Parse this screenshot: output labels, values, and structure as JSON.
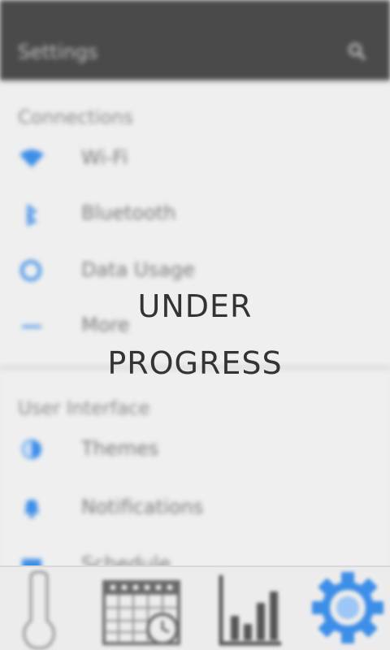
{
  "app_bar": {
    "title": "Settings",
    "search_icon": "search-icon"
  },
  "sections": [
    {
      "header": "Connections",
      "items": [
        {
          "label": "Wi-Fi",
          "icon": "wifi-icon"
        },
        {
          "label": "Bluetooth",
          "icon": "bluetooth-icon"
        },
        {
          "label": "Data Usage",
          "icon": "data-usage-icon"
        },
        {
          "label": "More",
          "icon": "more-icon"
        }
      ]
    },
    {
      "header": "User Interface",
      "items": [
        {
          "label": "Themes",
          "icon": "themes-icon"
        },
        {
          "label": "Notifications",
          "icon": "bell-icon"
        },
        {
          "label": "Schedule",
          "icon": "calendar-icon"
        }
      ]
    }
  ],
  "overlay": {
    "line1": "UNDER",
    "line2": "PROGRESS"
  },
  "tabbar": {
    "tabs": [
      {
        "icon": "thermometer-icon",
        "active": false
      },
      {
        "icon": "calendar-clock-icon",
        "active": false
      },
      {
        "icon": "bar-chart-icon",
        "active": false
      },
      {
        "icon": "gear-icon",
        "active": true
      }
    ]
  },
  "colors": {
    "app_bar": "#4a4a4a",
    "accent": "#3d8ee8",
    "background": "#efefef",
    "overlay_text": "#333333"
  }
}
